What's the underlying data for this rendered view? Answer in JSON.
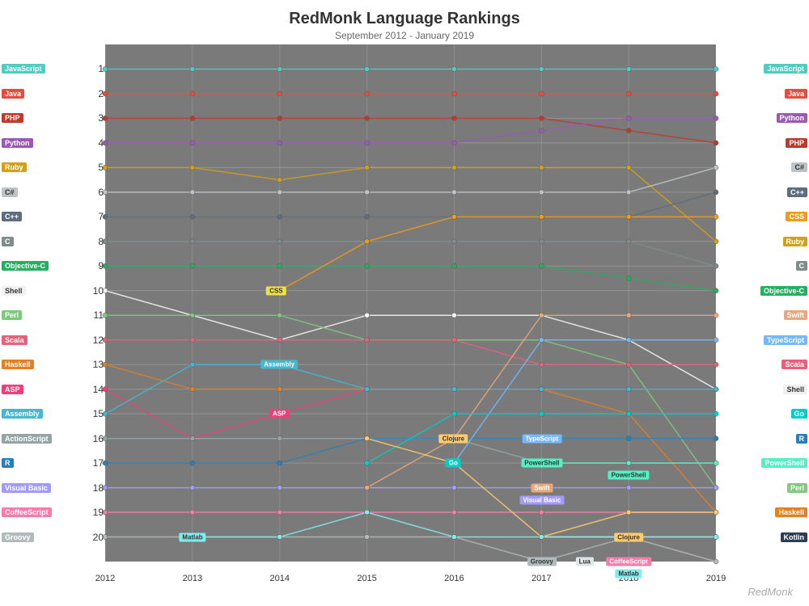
{
  "title": "RedMonk Language Rankings",
  "subtitle": "September 2012 - January 2019",
  "watermark": "RedMonk",
  "yLabels": [
    1,
    2,
    3,
    4,
    5,
    6,
    7,
    8,
    9,
    10,
    11,
    12,
    13,
    14,
    15,
    16,
    17,
    18,
    19,
    20
  ],
  "xLabels": [
    "2012",
    "2013",
    "2014",
    "2015",
    "2016",
    "2017",
    "2018",
    "2019"
  ],
  "leftLabels": [
    {
      "rank": 1,
      "text": "JavaScript",
      "color": "#4ECDC4"
    },
    {
      "rank": 2,
      "text": "Java",
      "color": "#E74C3C"
    },
    {
      "rank": 3,
      "text": "PHP",
      "color": "#C0392B"
    },
    {
      "rank": 4,
      "text": "Python",
      "color": "#9B59B6"
    },
    {
      "rank": 5,
      "text": "Ruby",
      "color": "#D4A017"
    },
    {
      "rank": 6,
      "text": "C#",
      "color": "#BDC3C7"
    },
    {
      "rank": 7,
      "text": "C++",
      "color": "#5D6D7E"
    },
    {
      "rank": 8,
      "text": "C",
      "color": "#7F8C8D"
    },
    {
      "rank": 9,
      "text": "Objective-C",
      "color": "#27AE60"
    },
    {
      "rank": 10,
      "text": "Shell",
      "color": "#F0F0F0"
    },
    {
      "rank": 11,
      "text": "Perl",
      "color": "#7FC97F"
    },
    {
      "rank": 12,
      "text": "Scala",
      "color": "#E8607A"
    },
    {
      "rank": 13,
      "text": "Haskell",
      "color": "#E67E22"
    },
    {
      "rank": 14,
      "text": "ASP",
      "color": "#EC407A"
    },
    {
      "rank": 15,
      "text": "Assembly",
      "color": "#45B7D1"
    },
    {
      "rank": 16,
      "text": "ActionScript",
      "color": "#95A5A6"
    },
    {
      "rank": 17,
      "text": "R",
      "color": "#2980B9"
    },
    {
      "rank": 18,
      "text": "Visual Basic",
      "color": "#A29BFE"
    },
    {
      "rank": 19,
      "text": "CoffeeScript",
      "color": "#FD79A8"
    },
    {
      "rank": 20,
      "text": "Groovy",
      "color": "#B2BABB"
    }
  ],
  "rightLabels": [
    {
      "rank": 1,
      "text": "JavaScript",
      "color": "#4ECDC4"
    },
    {
      "rank": 2,
      "text": "Java",
      "color": "#E74C3C"
    },
    {
      "rank": 3,
      "text": "Python",
      "color": "#9B59B6"
    },
    {
      "rank": 4,
      "text": "PHP",
      "color": "#C0392B"
    },
    {
      "rank": 5,
      "text": "C#",
      "color": "#BDC3C7"
    },
    {
      "rank": 6,
      "text": "C++",
      "color": "#5D6D7E"
    },
    {
      "rank": 7,
      "text": "CSS",
      "color": "#F39C12"
    },
    {
      "rank": 8,
      "text": "Ruby",
      "color": "#D4A017"
    },
    {
      "rank": 9,
      "text": "C",
      "color": "#7F8C8D"
    },
    {
      "rank": 10,
      "text": "Objective-C",
      "color": "#27AE60"
    },
    {
      "rank": 11,
      "text": "Swift",
      "color": "#E8A87C"
    },
    {
      "rank": 12,
      "text": "TypeScript",
      "color": "#74B9FF"
    },
    {
      "rank": 13,
      "text": "Scala",
      "color": "#E8607A"
    },
    {
      "rank": 14,
      "text": "Shell",
      "color": "#F0F0F0"
    },
    {
      "rank": 15,
      "text": "Go",
      "color": "#00CEC9"
    },
    {
      "rank": 16,
      "text": "R",
      "color": "#2980B9"
    },
    {
      "rank": 17,
      "text": "PowerShell",
      "color": "#55EFC4"
    },
    {
      "rank": 18,
      "text": "Perl",
      "color": "#7FC97F"
    },
    {
      "rank": 19,
      "text": "Haskell",
      "color": "#E67E22"
    },
    {
      "rank": 20,
      "text": "Kotlin",
      "color": "#2C3E50"
    }
  ]
}
